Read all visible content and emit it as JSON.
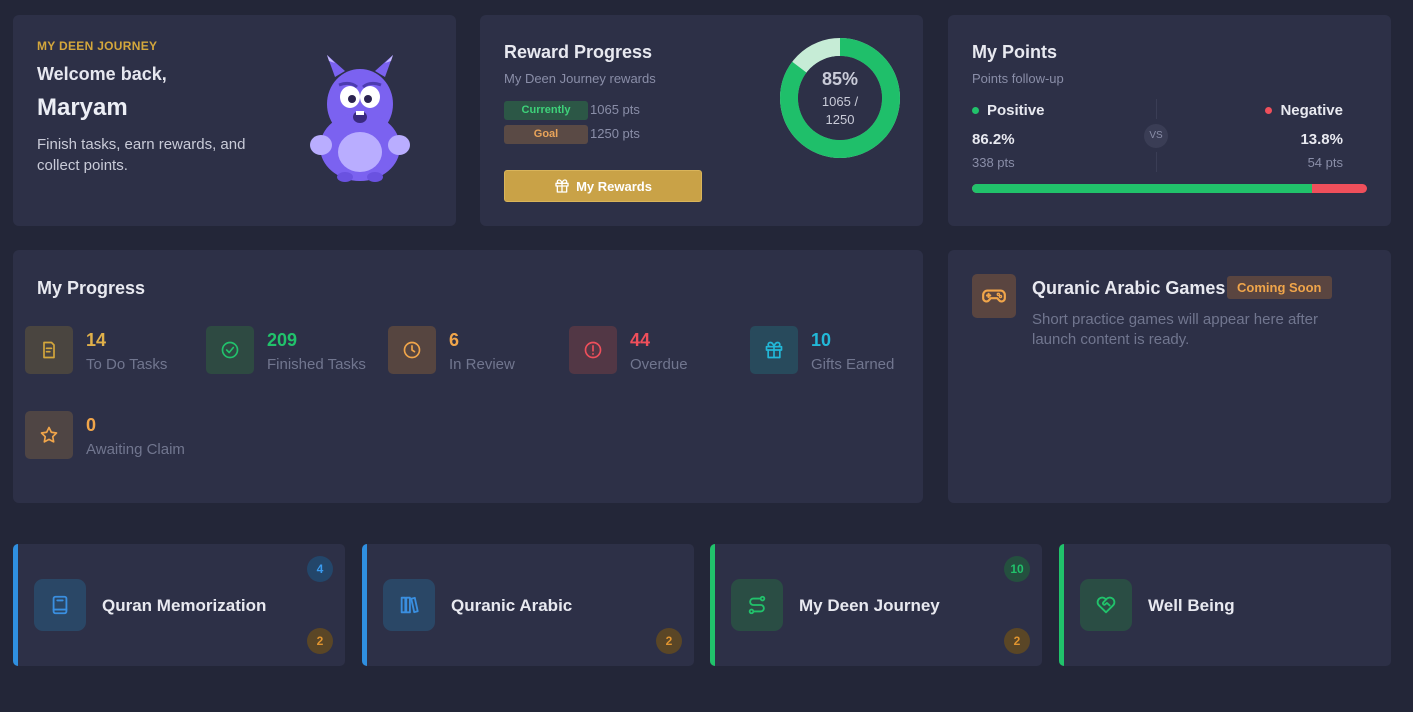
{
  "welcome": {
    "kicker": "MY DEEN JOURNEY",
    "greeting": "Welcome back,",
    "name": "Maryam",
    "description": "Finish tasks, earn rewards, and collect points."
  },
  "reward": {
    "title": "Reward Progress",
    "subtitle": "My Deen Journey rewards",
    "current_label": "Currently",
    "current_value": "1065 pts",
    "goal_label": "Goal",
    "goal_value": "1250 pts",
    "button": "My Rewards",
    "percent": "85%",
    "ratio": "1065 / 1250",
    "progress_fraction": 0.852
  },
  "points": {
    "title": "My Points",
    "subtitle": "Points follow-up",
    "positive_label": "Positive",
    "positive_pct": "86.2%",
    "positive_pts": "338 pts",
    "negative_label": "Negative",
    "negative_pct": "13.8%",
    "negative_pts": "54 pts",
    "vs": "VS",
    "positive_fraction": 0.862
  },
  "progress": {
    "title": "My Progress",
    "stats": [
      {
        "value": "14",
        "label": "To Do Tasks"
      },
      {
        "value": "209",
        "label": "Finished Tasks"
      },
      {
        "value": "6",
        "label": "In Review"
      },
      {
        "value": "44",
        "label": "Overdue"
      },
      {
        "value": "10",
        "label": "Gifts Earned"
      },
      {
        "value": "0",
        "label": "Awaiting Claim"
      }
    ]
  },
  "games": {
    "title": "Quranic Arabic Games",
    "badge": "Coming Soon",
    "description": "Short practice games will appear here after launch content is ready."
  },
  "courses": [
    {
      "name": "Quran Memorization",
      "top_badge": "4",
      "bottom_badge": "2"
    },
    {
      "name": "Quranic Arabic",
      "bottom_badge": "2"
    },
    {
      "name": "My Deen Journey",
      "top_badge": "10",
      "bottom_badge": "2"
    },
    {
      "name": "Well Being"
    }
  ],
  "colors": {
    "background": "#232638",
    "card": "#2d3047",
    "gold": "#c9a247",
    "green": "#21c26b",
    "red": "#ef4f5b",
    "blue": "#2f8fe0"
  }
}
